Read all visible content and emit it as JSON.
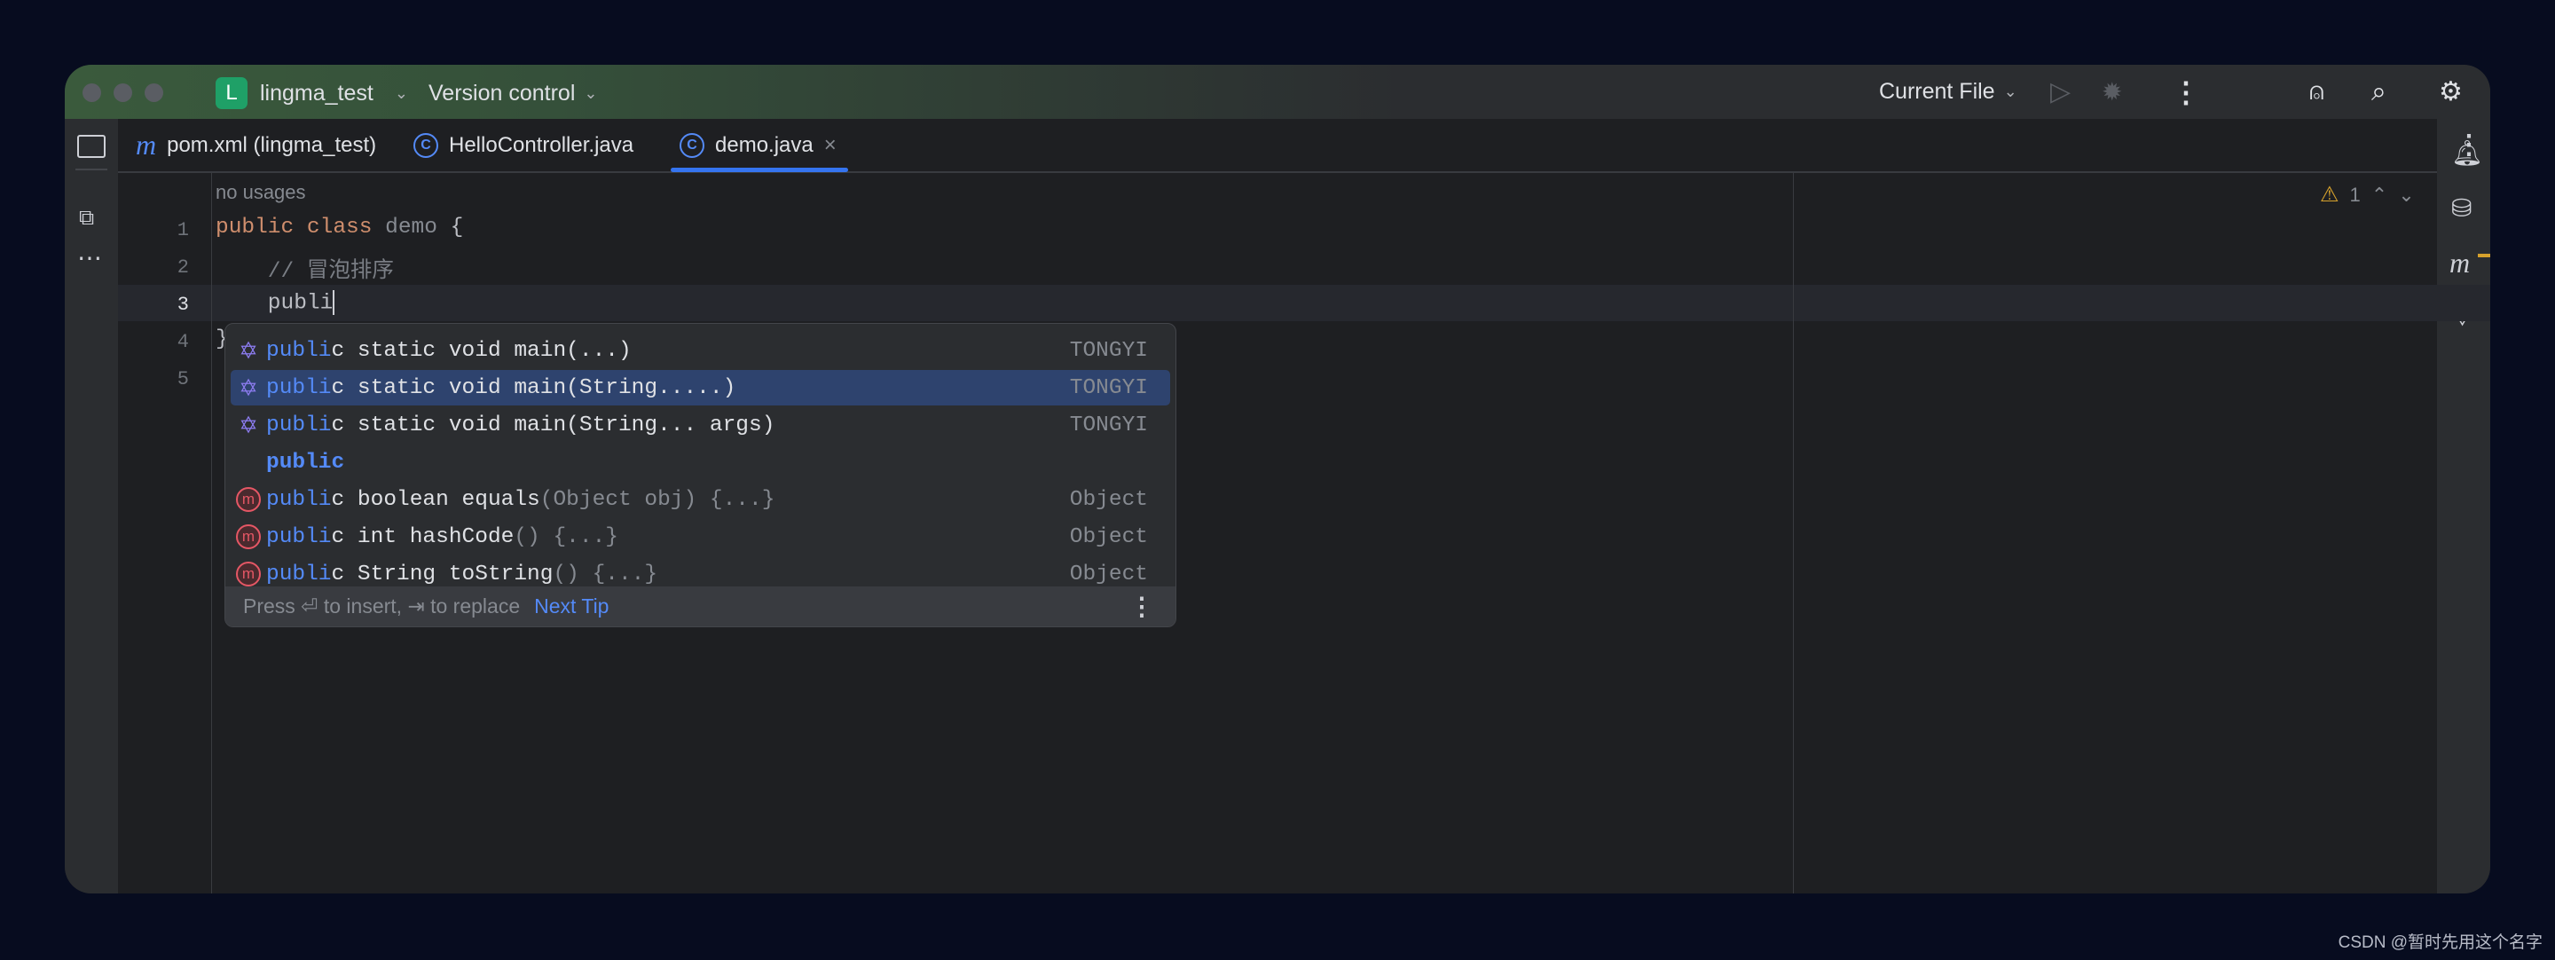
{
  "titlebar": {
    "project_initial": "L",
    "project": "lingma_test",
    "vcs": "Version control",
    "run_config": "Current File"
  },
  "tabs": [
    {
      "label": "pom.xml (lingma_test)",
      "icon": "maven-icon"
    },
    {
      "label": "HelloController.java",
      "icon": "class-icon"
    },
    {
      "label": "demo.java",
      "icon": "class-icon",
      "active": true,
      "close": "×"
    }
  ],
  "editor": {
    "usages_hint": "no usages",
    "warning_count": "1",
    "line_numbers": [
      "1",
      "2",
      "3",
      "4",
      "5"
    ],
    "lines": {
      "l1_kw": "public class ",
      "l1_name": "demo",
      "l1_rest": " {",
      "l2": "    // 冒泡排序",
      "l3": "    publi",
      "l4": "}"
    }
  },
  "completion": {
    "items": [
      {
        "match": "publi",
        "rest": "c static void main(...)",
        "dim": "",
        "source": "TONGYI",
        "icon": "tongyi-icon"
      },
      {
        "match": "publi",
        "rest": "c static void main(String.....)",
        "dim": "",
        "source": "TONGYI",
        "icon": "tongyi-icon",
        "selected": true
      },
      {
        "match": "publi",
        "rest": "c static void main(String... args)",
        "dim": "",
        "source": "TONGYI",
        "icon": "tongyi-icon"
      },
      {
        "match": "public",
        "rest": "",
        "dim": "",
        "source": "",
        "icon": "none"
      },
      {
        "match": "publi",
        "rest": "c boolean equals",
        "dim": "(Object obj) {...}",
        "source": "Object",
        "icon": "method-icon"
      },
      {
        "match": "publi",
        "rest": "c int hashCode",
        "dim": "() {...}",
        "source": "Object",
        "icon": "method-icon"
      },
      {
        "match": "publi",
        "rest": "c String toString",
        "dim": "() {...}",
        "source": "Object",
        "icon": "method-icon"
      }
    ],
    "footer_text": "Press ⏎ to insert, ⇥ to replace",
    "next_tip": "Next Tip"
  },
  "colors": {
    "accent": "#548af7",
    "selection": "#2e436e",
    "keyword": "#cf8e6d",
    "warning": "#d6a12c"
  }
}
